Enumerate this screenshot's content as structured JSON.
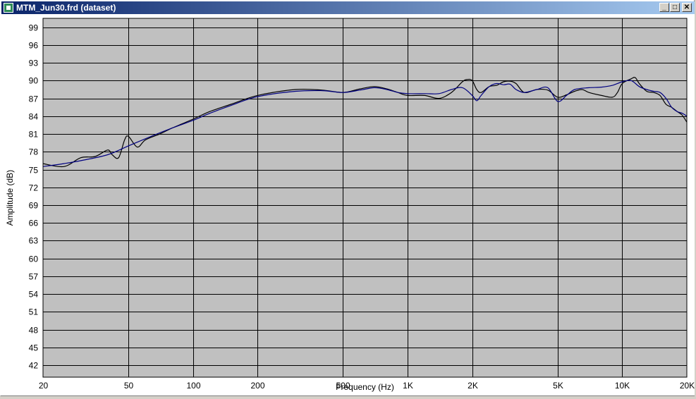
{
  "window": {
    "title": "MTM_Jun30.frd (dataset)",
    "buttons": {
      "minimize": "_",
      "maximize": "□",
      "close": "✕"
    }
  },
  "chart_data": {
    "type": "line",
    "xlabel": "Frequency (Hz)",
    "ylabel": "Amplitude (dB)",
    "x_scale": "log",
    "xlim": [
      20,
      20000
    ],
    "ylim": [
      40,
      100.5
    ],
    "grid": true,
    "background": "#c0c0c0",
    "x_ticks": [
      {
        "value": 20,
        "label": "20"
      },
      {
        "value": 50,
        "label": "50"
      },
      {
        "value": 100,
        "label": "100"
      },
      {
        "value": 200,
        "label": "200"
      },
      {
        "value": 500,
        "label": "500"
      },
      {
        "value": 1000,
        "label": "1K"
      },
      {
        "value": 2000,
        "label": "2K"
      },
      {
        "value": 5000,
        "label": "5K"
      },
      {
        "value": 10000,
        "label": "10K"
      },
      {
        "value": 20000,
        "label": "20K"
      }
    ],
    "y_ticks": [
      42,
      45,
      48,
      51,
      54,
      57,
      60,
      63,
      66,
      69,
      72,
      75,
      78,
      81,
      84,
      87,
      90,
      93,
      96,
      99
    ],
    "series": [
      {
        "color": "#000000",
        "x": [
          20,
          25,
          30,
          35,
          40,
          42,
          45,
          48,
          50,
          55,
          60,
          70,
          80,
          100,
          120,
          150,
          200,
          300,
          400,
          500,
          600,
          700,
          800,
          900,
          1000,
          1200,
          1400,
          1600,
          1800,
          1900,
          2000,
          2100,
          2200,
          2400,
          2600,
          2800,
          3000,
          3200,
          3500,
          4000,
          4500,
          5000,
          5500,
          6000,
          6500,
          7000,
          8000,
          9000,
          9500,
          10000,
          11000,
          11500,
          12000,
          13000,
          14000,
          15000,
          16000,
          17000,
          18000,
          19000,
          20000
        ],
        "y": [
          76.0,
          75.5,
          77.0,
          77.2,
          78.3,
          77.5,
          77.0,
          80.0,
          80.6,
          78.8,
          80.0,
          81.0,
          82.0,
          83.5,
          84.8,
          86.0,
          87.5,
          88.5,
          88.4,
          88.0,
          88.6,
          89.0,
          88.6,
          88.0,
          87.5,
          87.5,
          87.0,
          88.0,
          89.8,
          90.2,
          90.0,
          88.5,
          88.0,
          89.0,
          89.2,
          89.8,
          89.9,
          89.5,
          88.0,
          88.5,
          88.4,
          87.2,
          87.6,
          88.2,
          88.5,
          88.0,
          87.5,
          87.2,
          88.0,
          89.5,
          90.3,
          90.5,
          89.5,
          88.2,
          88.0,
          87.5,
          86.0,
          85.5,
          84.8,
          84.2,
          83.0
        ]
      },
      {
        "color": "#000080",
        "x": [
          20,
          25,
          30,
          40,
          50,
          60,
          70,
          80,
          100,
          120,
          150,
          200,
          300,
          400,
          500,
          600,
          700,
          800,
          900,
          1000,
          1200,
          1400,
          1600,
          1800,
          2000,
          2100,
          2200,
          2400,
          2600,
          2800,
          3000,
          3200,
          3500,
          4000,
          4500,
          5000,
          5500,
          6000,
          7000,
          8000,
          9000,
          10000,
          11000,
          12000,
          13000,
          14000,
          15000,
          16000,
          17000,
          18000,
          19000,
          20000
        ],
        "y": [
          75.5,
          76.0,
          76.5,
          77.5,
          79.0,
          80.2,
          81.2,
          82.0,
          83.3,
          84.5,
          85.8,
          87.3,
          88.2,
          88.3,
          88.0,
          88.4,
          88.8,
          88.5,
          88.0,
          87.8,
          87.8,
          87.8,
          88.5,
          88.8,
          87.5,
          86.6,
          87.5,
          89.0,
          89.5,
          89.3,
          89.4,
          88.5,
          88.0,
          88.5,
          88.8,
          86.5,
          87.5,
          88.5,
          88.8,
          88.9,
          89.2,
          89.8,
          90.0,
          89.0,
          88.5,
          88.2,
          88.0,
          87.0,
          85.5,
          84.8,
          84.5,
          84.0
        ]
      }
    ]
  }
}
